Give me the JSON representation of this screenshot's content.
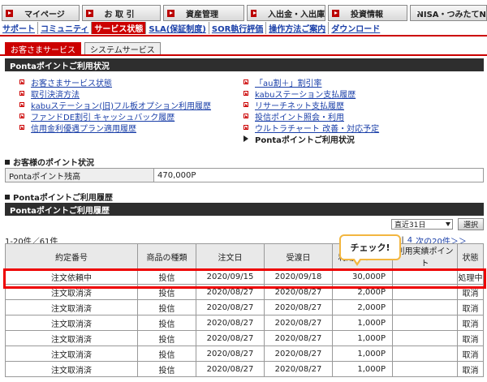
{
  "top_nav": [
    "マイページ",
    "お 取 引",
    "資産管理",
    "入出金・入出庫",
    "投資情報",
    "NISA・つみたてNISA"
  ],
  "sub_nav": [
    {
      "label": "サポート",
      "active": false
    },
    {
      "label": "コミュニティ",
      "active": false
    },
    {
      "label": "サービス状態",
      "active": true
    },
    {
      "label": "SLA(保証制度)",
      "active": false
    },
    {
      "label": "SOR執行評価",
      "active": false
    },
    {
      "label": "操作方法ご案内",
      "active": false
    },
    {
      "label": "ダウンロード",
      "active": false
    }
  ],
  "service_tabs": {
    "customer": "お客さまサービス",
    "system": "システムサービス"
  },
  "section_title": "Pontaポイントご利用状況",
  "links_left": [
    "お客さまサービス状態",
    "取引決済方法",
    "kabuステーション(旧)フル板オプション利用履歴",
    "ファンドDE割引 キャッシュバック履歴",
    "信用金利優遇プラン適用履歴"
  ],
  "links_right": [
    "「au割＋」割引率",
    "kabuステーション支払履歴",
    "リサーチネット支払履歴",
    "投信ポイント照会・利用",
    "ウルトラチャート 改善・対応予定"
  ],
  "links_current": "Pontaポイントご利用状況",
  "balance_section": "お客様のポイント状況",
  "balance": {
    "label": "Pontaポイント残高",
    "value": "470,000P"
  },
  "history_section": "Pontaポイントご利用履歴",
  "history_bar": "Pontaポイントご利用履歴",
  "period": "直近31日",
  "select_button": "選択",
  "count_text": "1-20件／61件",
  "pager": {
    "pages": [
      "3",
      "4"
    ],
    "next": "次の20件＞＞"
  },
  "callout": "チェック!",
  "table": {
    "headers": [
      "約定番号",
      "商品の種類",
      "注文日",
      "受渡日",
      "利用ポイント",
      "利用実績ポイント",
      "状態"
    ],
    "rows": [
      [
        "注文依頼中",
        "投信",
        "2020/09/15",
        "2020/09/18",
        "30,000P",
        "",
        "処理中"
      ],
      [
        "注文取消済",
        "投信",
        "2020/08/27",
        "2020/08/27",
        "2,000P",
        "",
        "取消"
      ],
      [
        "注文取消済",
        "投信",
        "2020/08/27",
        "2020/08/27",
        "2,000P",
        "",
        "取消"
      ],
      [
        "注文取消済",
        "投信",
        "2020/08/27",
        "2020/08/27",
        "1,000P",
        "",
        "取消"
      ],
      [
        "注文取消済",
        "投信",
        "2020/08/27",
        "2020/08/27",
        "1,000P",
        "",
        "取消"
      ],
      [
        "注文取消済",
        "投信",
        "2020/08/27",
        "2020/08/27",
        "1,000P",
        "",
        "取消"
      ],
      [
        "注文取消済",
        "投信",
        "2020/08/27",
        "2020/08/27",
        "1,000P",
        "",
        "取消"
      ]
    ]
  },
  "colors": {
    "brand_red": "#cc0000",
    "link_blue": "#1a3fa8",
    "callout_border": "#f2b640"
  }
}
